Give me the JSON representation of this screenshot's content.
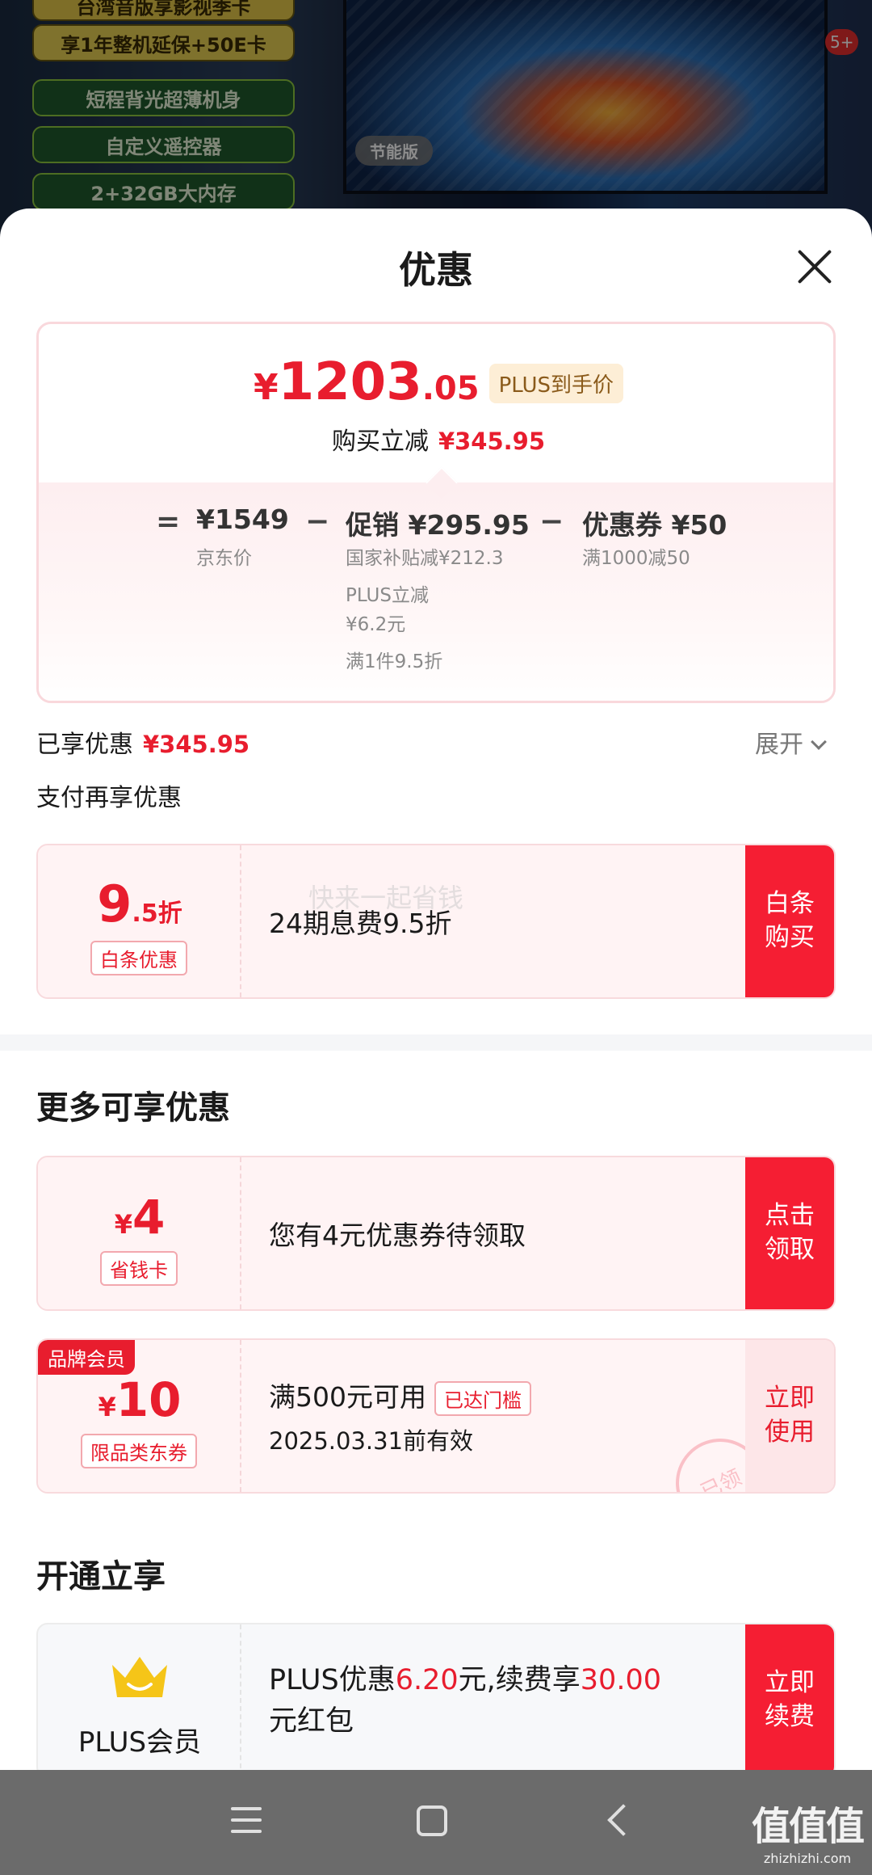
{
  "background": {
    "pills": [
      "台湾音版享影视季卡",
      "享1年整机延保+50E卡",
      "短程背光超薄机身",
      "自定义遥控器",
      "2+32GB大内存"
    ],
    "tv_badge": "节能版",
    "notification_count": "5+"
  },
  "sheet": {
    "title": "优惠"
  },
  "price_card": {
    "currency": "¥",
    "price_int": "1203",
    "price_dec": ".05",
    "plus_tag": "PLUS到手价",
    "reduce_label": "购买立减",
    "reduce_value": "¥345.95",
    "eq": "=",
    "minus": "−",
    "jd_price": "¥1549",
    "jd_label": "京东价",
    "promo": "促销 ¥295.95",
    "promo_sub1": "国家补贴减¥212.3",
    "promo_sub2a": "PLUS立减",
    "promo_sub2b": "¥6.2元",
    "promo_sub3": "满1件9.5折",
    "coupon": "优惠券 ¥50",
    "coupon_sub": "满1000减50"
  },
  "enjoyed": {
    "label": "已享优惠",
    "value": "¥345.95",
    "expand": "展开"
  },
  "pay_section": {
    "title": "支付再享优惠"
  },
  "baitiao": {
    "discount_big": "9",
    "discount_small": ".5折",
    "tag": "白条优惠",
    "text": "24期息费9.5折",
    "watermark": "快来一起省钱",
    "button_l1": "白条",
    "button_l2": "购买"
  },
  "more_section": {
    "title": "更多可享优惠"
  },
  "saving_card": {
    "currency": "¥",
    "value": "4",
    "tag": "省钱卡",
    "text": "您有4元优惠券待领取",
    "button_l1": "点击",
    "button_l2": "领取"
  },
  "brand_coupon": {
    "corner": "品牌会员",
    "currency": "¥",
    "value": "10",
    "tag": "限品类东券",
    "text": "满500元可用",
    "reached": "已达门槛",
    "expiry": "2025.03.31前有效",
    "stamp": "已领",
    "button_l1": "立即",
    "button_l2": "使用"
  },
  "open_section": {
    "title": "开通立享"
  },
  "plus_card": {
    "label": "PLUS会员",
    "t1": "PLUS优惠",
    "v1": "6.20",
    "t2": "元,续费享",
    "v2": "30.00",
    "t3": "元红包",
    "button_l1": "立即",
    "button_l2": "续费"
  },
  "logo": {
    "name": "值值值",
    "url": "zhizhizhi.com"
  },
  "colors": {
    "accent": "#e81d2e",
    "button": "#f51e33",
    "plus_gold": "#f5c518"
  }
}
